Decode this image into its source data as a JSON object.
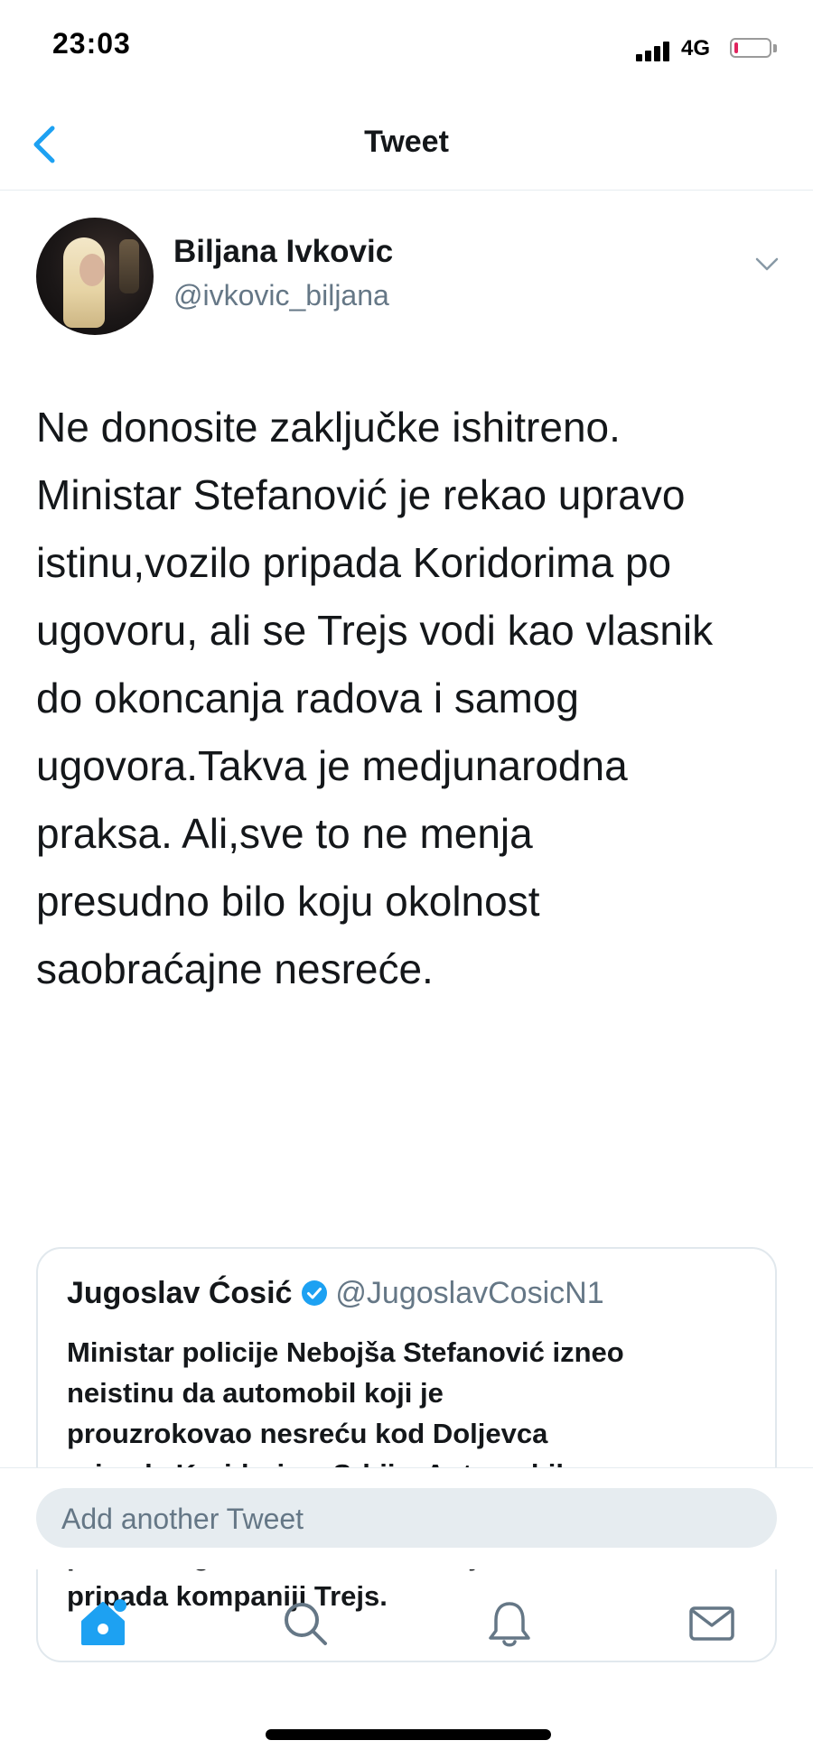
{
  "status_bar": {
    "time": "23:03",
    "network": "4G",
    "battery_level": 0.1,
    "battery_color": "#e0245e"
  },
  "header": {
    "title": "Tweet",
    "back_icon": "chevron-left-icon"
  },
  "tweet": {
    "author_name": "Biljana Ivkovic",
    "author_handle": "@ivkovic_biljana",
    "text": "Ne donosite zaključke ishitreno.\nMinistar Stefanović je rekao upravo\nistinu,vozilo pripada  Koridorima po\nugovoru, ali se Trejs vodi kao vlasnik\ndo okoncanja radova i samog\nugovora.Takva je medjunarodna\npraksa. Ali,sve to ne menja\npresudno bilo koju okolnost\nsaobraćajne nesreće."
  },
  "quote": {
    "author_name": "Jugoslav Ćosić",
    "author_handle": "@JugoslavCosicN1",
    "verified": true,
    "text": "Ministar policije Nebojša Stefanović izneo\nneistinu da automobil koji je\nprouzrokovao nesreću kod Doljevca\npripada Koridorima Srbije. Automobil,\nprema izveštaju nadležnog tužioca a i\nprema odgovoru vlasnika Insajderu\npripada kompaniji Trejs."
  },
  "reply": {
    "placeholder": "Add another Tweet"
  },
  "tab_bar": {
    "items": [
      "home-icon",
      "search-icon",
      "notifications-icon",
      "messages-icon"
    ],
    "active": "home-icon",
    "accent_color": "#1da1f2"
  },
  "colors": {
    "accent": "#1da1f2",
    "text_primary": "#14171a",
    "text_secondary": "#657786",
    "border": "#e1e8ed"
  }
}
